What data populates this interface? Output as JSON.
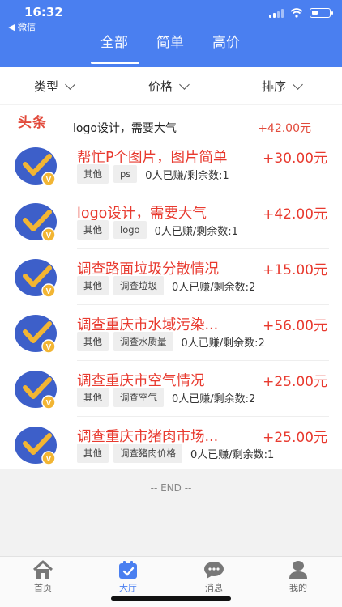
{
  "status_bar": {
    "time": "16:32",
    "back_label": "◀ 微信"
  },
  "tabs": [
    {
      "label": "全部",
      "active": true
    },
    {
      "label": "简单",
      "active": false
    },
    {
      "label": "高价",
      "active": false
    }
  ],
  "filters": [
    {
      "label": "类型"
    },
    {
      "label": "价格"
    },
    {
      "label": "排序"
    }
  ],
  "headline": {
    "badge": "头条",
    "title": "logo设计，需要大气",
    "amount": "+42.00元"
  },
  "tasks": [
    {
      "title": "帮忙P个图片，图片简单",
      "amount": "+30.00元",
      "tags": [
        "其他",
        "ps"
      ],
      "stats": "0人已赚/剩余数:1"
    },
    {
      "title": "logo设计，需要大气",
      "amount": "+42.00元",
      "tags": [
        "其他",
        "logo"
      ],
      "stats": "0人已赚/剩余数:1"
    },
    {
      "title": "调查路面垃圾分散情况",
      "amount": "+15.00元",
      "tags": [
        "其他",
        "调查垃圾"
      ],
      "stats": "0人已赚/剩余数:2"
    },
    {
      "title": "调查重庆市水域污染...",
      "amount": "+56.00元",
      "tags": [
        "其他",
        "调查水质量"
      ],
      "stats": "0人已赚/剩余数:2"
    },
    {
      "title": "调查重庆市空气情况",
      "amount": "+25.00元",
      "tags": [
        "其他",
        "调查空气"
      ],
      "stats": "0人已赚/剩余数:2"
    },
    {
      "title": "调查重庆市猪肉市场...",
      "amount": "+25.00元",
      "tags": [
        "其他",
        "调查猪肉价格"
      ],
      "stats": "0人已赚/剩余数:1"
    }
  ],
  "avatar_badge": "V",
  "end_text": "-- END --",
  "bottom_nav": [
    {
      "label": "首页",
      "icon": "home-icon",
      "active": false
    },
    {
      "label": "大厅",
      "icon": "calendar-icon",
      "active": true
    },
    {
      "label": "消息",
      "icon": "chat-icon",
      "active": false
    },
    {
      "label": "我的",
      "icon": "user-icon",
      "active": false
    }
  ],
  "colors": {
    "primary": "#4a7ff0",
    "accent_red": "#e83a2f",
    "avatar_bg": "#3d5fc9",
    "avatar_check": "#f2b533"
  }
}
